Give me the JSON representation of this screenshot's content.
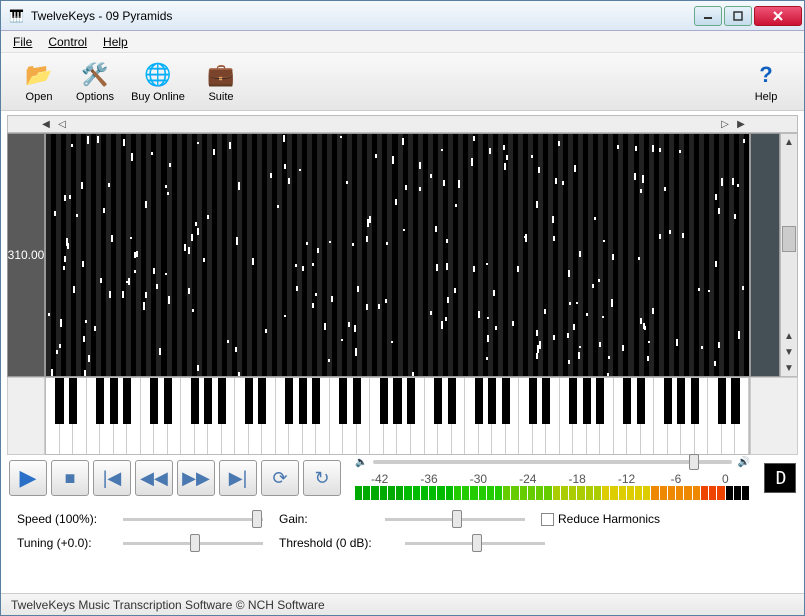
{
  "title": "TwelveKeys - 09 Pyramids",
  "menu": {
    "file": "File",
    "control": "Control",
    "help": "Help"
  },
  "toolbar": {
    "open": "Open",
    "options": "Options",
    "buy": "Buy Online",
    "suite": "Suite",
    "help": "Help"
  },
  "time_label": "310.00",
  "transport": {
    "play": "▶",
    "stop": "■",
    "start": "|◀",
    "rew": "◀◀",
    "ff": "▶▶",
    "end": "▶|",
    "cycle": "⟳",
    "loop": "↻"
  },
  "db_ticks": [
    "-42",
    "-36",
    "-30",
    "-24",
    "-18",
    "-12",
    "-6",
    "0"
  ],
  "digit": "D",
  "sliders": {
    "speed_label": "Speed (100%):",
    "gain_label": "Gain:",
    "reduce_label": "Reduce Harmonics",
    "tuning_label": "Tuning (+0.0):",
    "threshold_label": "Threshold (0 dB):"
  },
  "status": "TwelveKeys Music Transcription Software   © NCH Software"
}
